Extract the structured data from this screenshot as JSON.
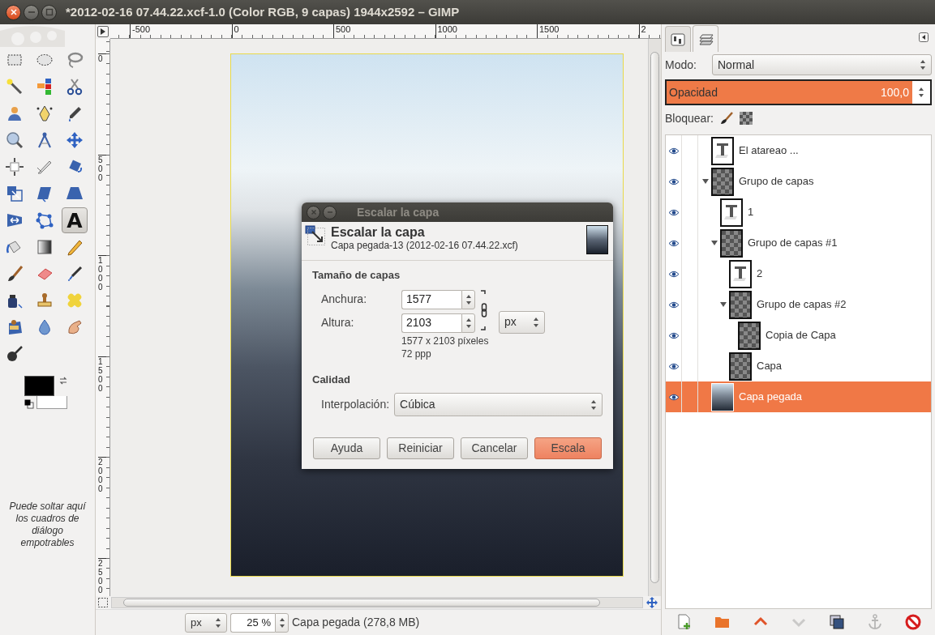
{
  "window": {
    "title": "*2012-02-16 07.44.22.xcf-1.0 (Color RGB, 9 capas) 1944x2592 – GIMP"
  },
  "toolbox": {
    "tools": [
      {
        "kind": "rect-select",
        "selected": false
      },
      {
        "kind": "ellipse-select",
        "selected": false
      },
      {
        "kind": "free-select",
        "selected": false
      },
      {
        "kind": "fuzzy-select",
        "selected": false
      },
      {
        "kind": "color-select",
        "selected": false
      },
      {
        "kind": "scissors",
        "selected": false
      },
      {
        "kind": "foreground-select",
        "selected": false
      },
      {
        "kind": "paths",
        "selected": false
      },
      {
        "kind": "color-picker",
        "selected": false
      },
      {
        "kind": "zoom",
        "selected": false
      },
      {
        "kind": "measure",
        "selected": false
      },
      {
        "kind": "move",
        "selected": false
      },
      {
        "kind": "align",
        "selected": false
      },
      {
        "kind": "crop",
        "selected": false
      },
      {
        "kind": "rotate",
        "selected": false
      },
      {
        "kind": "scale",
        "selected": false
      },
      {
        "kind": "shear",
        "selected": false
      },
      {
        "kind": "perspective",
        "selected": false
      },
      {
        "kind": "flip",
        "selected": false
      },
      {
        "kind": "cage",
        "selected": false
      },
      {
        "kind": "text",
        "selected": true,
        "glyph": "A"
      },
      {
        "kind": "bucket",
        "selected": false
      },
      {
        "kind": "gradient",
        "selected": false
      },
      {
        "kind": "pencil",
        "selected": false
      },
      {
        "kind": "brush",
        "selected": false
      },
      {
        "kind": "eraser",
        "selected": false
      },
      {
        "kind": "airbrush",
        "selected": false
      },
      {
        "kind": "ink",
        "selected": false
      },
      {
        "kind": "clone",
        "selected": false
      },
      {
        "kind": "heal",
        "selected": false
      },
      {
        "kind": "perspective-clone",
        "selected": false
      },
      {
        "kind": "blur",
        "selected": false
      },
      {
        "kind": "smudge",
        "selected": false
      },
      {
        "kind": "dodge",
        "selected": false
      }
    ],
    "colors": {
      "foreground": {
        "color": "#000000"
      },
      "background": {
        "color": "#ffffff"
      }
    },
    "hint": "Puede soltar aquí los cuadros de diálogo empotrables"
  },
  "rulers": {
    "horizontal": [
      "-500",
      "0",
      "500",
      "1000",
      "1500",
      "2"
    ],
    "vertical": [
      "0",
      "500",
      "1000",
      "1500",
      "2000",
      "2500"
    ]
  },
  "status_bar": {
    "unit": "px",
    "zoom": "25 %",
    "message": "Capa pegada (278,8 MB)"
  },
  "dialog": {
    "title": "Escalar la capa",
    "heading": "Escalar la capa",
    "subtitle": "Capa pegada-13 (2012-02-16 07.44.22.xcf)",
    "size_section": "Tamaño de capas",
    "width": {
      "label": "Anchura:",
      "value": "1577"
    },
    "height": {
      "label": "Altura:",
      "value": "2103"
    },
    "unit": "px",
    "size_info": "1577 x 2103 píxeles",
    "resolution": "72 ppp",
    "quality_section": "Calidad",
    "interpolation": {
      "label": "Interpolación:",
      "value": "Cúbica"
    },
    "buttons": [
      {
        "label": "Ayuda",
        "kind": "normal"
      },
      {
        "label": "Reiniciar",
        "kind": "normal"
      },
      {
        "label": "Cancelar",
        "kind": "normal"
      },
      {
        "label": "Escala",
        "kind": "default"
      }
    ]
  },
  "dock": {
    "tabs": [
      {
        "kind": "tool-options",
        "selected": false
      },
      {
        "kind": "layers",
        "selected": true
      }
    ],
    "mode": {
      "label": "Modo:",
      "value": "Normal"
    },
    "opacity": {
      "label": "Opacidad",
      "reading": "100,0",
      "level": 1
    },
    "lock": {
      "label": "Bloquear:"
    },
    "layers": [
      {
        "name": "El atareao ...",
        "kind": "text",
        "visible": true,
        "selected": false
      },
      {
        "name": "Grupo de capas",
        "kind": "group",
        "visible": true,
        "selected": false,
        "expanded": true,
        "children": [
          {
            "name": "1",
            "kind": "text",
            "visible": true,
            "selected": false
          },
          {
            "name": "Grupo de capas #1",
            "kind": "group",
            "visible": true,
            "selected": false,
            "expanded": true,
            "children": [
              {
                "name": "2",
                "kind": "text",
                "visible": true,
                "selected": false
              },
              {
                "name": "Grupo de capas #2",
                "kind": "group",
                "visible": true,
                "selected": false,
                "expanded": true,
                "children": [
                  {
                    "name": "Copia de Capa",
                    "kind": "layer",
                    "visible": true,
                    "selected": false
                  }
                ]
              },
              {
                "name": "Capa",
                "kind": "layer",
                "visible": true,
                "selected": false
              }
            ]
          }
        ]
      },
      {
        "name": "Capa pegada",
        "kind": "photo",
        "visible": true,
        "selected": true
      }
    ],
    "actions": [
      {
        "kind": "new-layer",
        "disabled": false
      },
      {
        "kind": "new-group",
        "disabled": false
      },
      {
        "kind": "raise",
        "disabled": false
      },
      {
        "kind": "lower",
        "disabled": true
      },
      {
        "kind": "duplicate",
        "disabled": false
      },
      {
        "kind": "anchor",
        "disabled": true
      },
      {
        "kind": "delete",
        "disabled": false
      }
    ]
  }
}
